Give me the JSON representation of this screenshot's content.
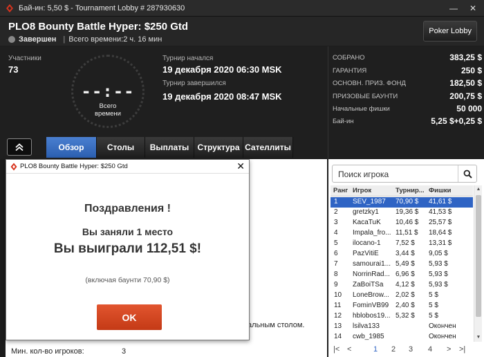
{
  "titlebar": {
    "title": "Бай-ин: 5,50 $ - Tournament Lobby # 287930630",
    "minimize": "—",
    "close": "✕"
  },
  "header": {
    "tournament_name": "PLO8 Bounty Battle Hyper: $250 Gtd",
    "status": "Завершен",
    "separator": "|",
    "total_time": "Всего времени:2 ч. 16 мин",
    "poker_lobby_button": "Poker Lobby"
  },
  "info": {
    "participants_label": "Участники",
    "participants_value": "73",
    "clock_digits": "--:--",
    "clock_caption_1": "Всего",
    "clock_caption_2": "времени",
    "started_label": "Турнир начался",
    "started_value": "19 декабря 2020   06:30 MSK",
    "ended_label": "Турнир завершился",
    "ended_value": "19 декабря 2020   08:47 MSK"
  },
  "stats": [
    {
      "label": "СОБРАНО",
      "value": "383,25 $"
    },
    {
      "label": "ГАРАНТИЯ",
      "value": "250 $"
    },
    {
      "label": "ОСНОВН. ПРИЗ. ФОНД",
      "value": "182,50 $"
    },
    {
      "label": "ПРИЗОВЫЕ БАУНТИ",
      "value": "200,75 $"
    },
    {
      "label": "Начальные фишки",
      "value": "50 000"
    },
    {
      "label": "Бай-ин",
      "value": "5,25 $+0,25 $"
    }
  ],
  "tabs": [
    "Обзор",
    "Столы",
    "Выплаты",
    "Структура",
    "Сателлиты"
  ],
  "content": {
    "side_text": "альным столом.",
    "min_players_label": "Мин. кол-во игроков:",
    "min_players_value": "3"
  },
  "popup": {
    "title": "PLO8 Bounty Battle Hyper: $250 Gtd",
    "close": "✕",
    "congrats": "Поздравления !",
    "place_text": "Вы заняли 1 место",
    "won_text": "Вы выиграли 112,51 $!",
    "includes_text": "(включая баунти 70,90 $)",
    "ok_button": "OK"
  },
  "players": {
    "search_placeholder": "Поиск игрока",
    "columns": [
      "Ранг",
      "Игрок",
      "Турнир...",
      "Фишки"
    ],
    "rows": [
      [
        "1",
        "SEV_1987",
        "70,90 $",
        "41,61 $"
      ],
      [
        "2",
        "gretzky1",
        "19,36 $",
        "41,53 $"
      ],
      [
        "3",
        "KacaTuK",
        "10,46 $",
        "25,57 $"
      ],
      [
        "4",
        "Impala_fro...",
        "11,51 $",
        "18,64 $"
      ],
      [
        "5",
        "ilocano-1",
        "7,52 $",
        "13,31 $"
      ],
      [
        "6",
        "PazVitiE",
        "3,44 $",
        "9,05 $"
      ],
      [
        "7",
        "samourai1...",
        "5,49 $",
        "5,93 $"
      ],
      [
        "8",
        "NorrinRad...",
        "6,96 $",
        "5,93 $"
      ],
      [
        "9",
        "ZaBoiTSa",
        "4,12 $",
        "5,93 $"
      ],
      [
        "10",
        "LoneBrow...",
        "2,02 $",
        "5 $"
      ],
      [
        "11",
        "FominVB99",
        "2,40 $",
        "5 $"
      ],
      [
        "12",
        "hblobos19...",
        "5,32 $",
        "5 $"
      ],
      [
        "13",
        "lsilva133",
        "",
        "Окончен"
      ],
      [
        "14",
        "cwb_1985",
        "",
        "Окончен"
      ]
    ],
    "pager": [
      "|<",
      "<",
      "1",
      "2",
      "3",
      "4",
      ">",
      ">|"
    ]
  },
  "colors": {
    "accent_blue": "#2f64c4",
    "ok_orange": "#d24a22",
    "brand_red": "#d8341e"
  }
}
